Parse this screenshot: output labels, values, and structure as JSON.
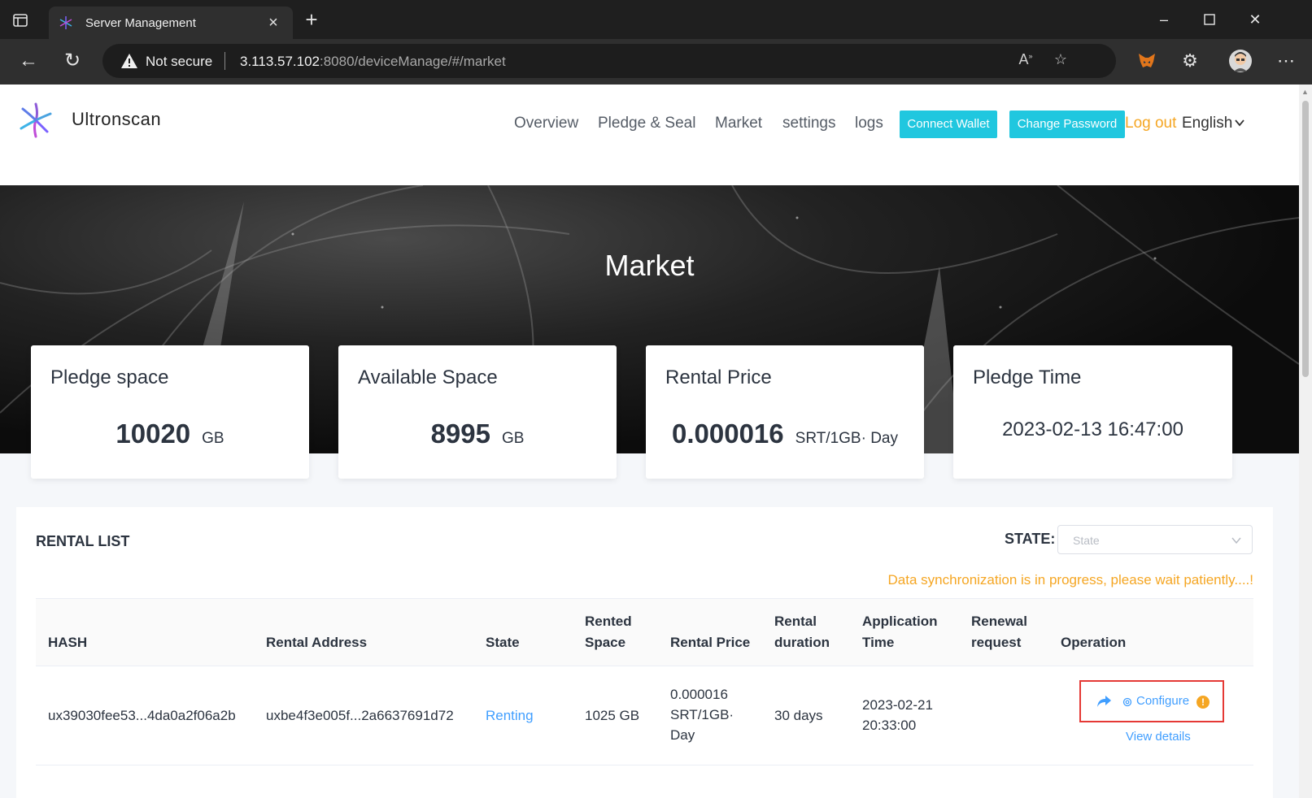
{
  "browser": {
    "tab_title": "Server Management",
    "security_label": "Not secure",
    "url_host": "3.113.57.102",
    "url_rest": ":8080/deviceManage/#/market"
  },
  "header": {
    "brand": "Ultronscan",
    "nav": [
      {
        "label": "Overview"
      },
      {
        "label": "Pledge & Seal"
      },
      {
        "label": "Market"
      },
      {
        "label": "settings"
      },
      {
        "label": "logs"
      }
    ],
    "connect_wallet": "Connect Wallet",
    "change_password": "Change Password",
    "logout": "Log out",
    "language": "English"
  },
  "hero": {
    "title": "Market"
  },
  "cards": [
    {
      "title": "Pledge space",
      "value": "10020",
      "unit": "GB"
    },
    {
      "title": "Available Space",
      "value": "8995",
      "unit": "GB"
    },
    {
      "title": "Rental Price",
      "value": "0.000016",
      "unit": "SRT/1GB· Day"
    },
    {
      "title": "Pledge Time",
      "value": "2023-02-13 16:47:00"
    }
  ],
  "rental": {
    "title": "RENTAL LIST",
    "state_label": "STATE:",
    "state_placeholder": "State",
    "sync_message": "Data synchronization is in progress, please wait patiently....!",
    "columns": {
      "hash": "HASH",
      "address": "Rental Address",
      "state": "State",
      "space_1": "Rented",
      "space_2": "Space",
      "price": "Rental Price",
      "duration_1": "Rental",
      "duration_2": "duration",
      "apptime_1": "Application",
      "apptime_2": "Time",
      "renewal_1": "Renewal",
      "renewal_2": "request",
      "operation": "Operation"
    },
    "rows": [
      {
        "hash": "ux39030fee53...4da0a2f06a2b",
        "address": "uxbe4f3e005f...2a6637691d72",
        "state": "Renting",
        "space": "1025 GB",
        "price_1": "0.000016",
        "price_2": "SRT/1GB·",
        "price_3": "Day",
        "duration": "30 days",
        "apptime_1": "2023-02-21",
        "apptime_2": "20:33:00",
        "renewal": "",
        "configure": "Configure",
        "warn": "!",
        "view_details": "View details"
      }
    ]
  },
  "colors": {
    "accent_cyan": "#20c7df",
    "link_blue": "#409eff",
    "warning_orange": "#f5a623",
    "highlight_red": "#e53935"
  }
}
